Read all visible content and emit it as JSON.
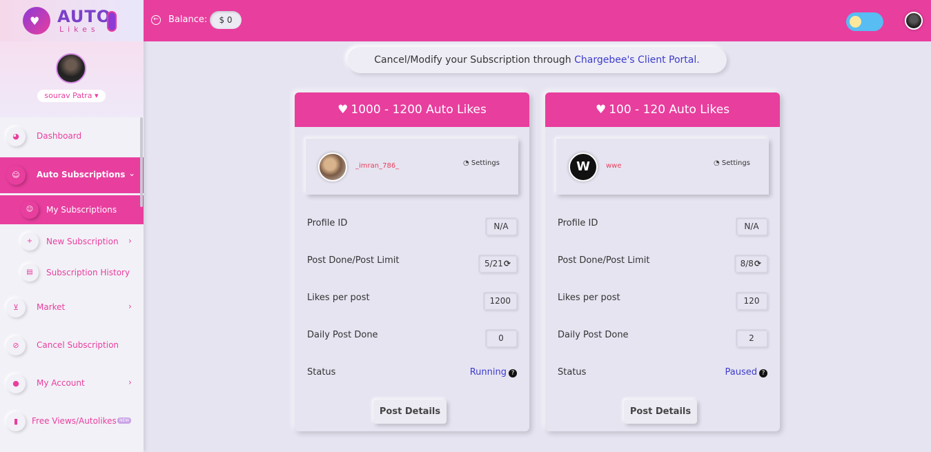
{
  "brand": {
    "name": "AUTO",
    "sub": "Likes",
    "badge": "IG"
  },
  "user": {
    "name": "sourav Patra"
  },
  "header": {
    "balance_label": "Balance:",
    "balance_value": "$ 0"
  },
  "sidebar": {
    "items": [
      {
        "label": "Dashboard",
        "icon": "pie-chart-icon"
      },
      {
        "label": "Auto Subscriptions",
        "icon": "users-icon",
        "chevron": "⌄"
      },
      {
        "label": "Market",
        "icon": "cart-icon",
        "chevron": "›"
      },
      {
        "label": "Cancel Subscription",
        "icon": "ban-icon"
      },
      {
        "label": "My Account",
        "icon": "user-icon",
        "chevron": "›"
      },
      {
        "label": "Free Views/Autolikes",
        "icon": "bookmark-icon",
        "badge": "NEW"
      }
    ],
    "subitems": [
      {
        "label": "My Subscriptions",
        "icon": "users-icon"
      },
      {
        "label": "New Subscription",
        "icon": "user-plus-icon",
        "chevron": "›"
      },
      {
        "label": "Subscription History",
        "icon": "clipboard-icon"
      }
    ]
  },
  "banner": {
    "text": "Cancel/Modify your Subscription through ",
    "link": "Chargebee's Client Portal."
  },
  "rows": {
    "profile_id": "Profile ID",
    "post_done": "Post Done/Post Limit",
    "likes_per_post": "Likes per post",
    "daily_post_done": "Daily Post Done",
    "status": "Status"
  },
  "cards": [
    {
      "title": "1000 - 1200 Auto Likes",
      "username": "_imran_786_",
      "settings": "Settings",
      "profile_id": "N/A",
      "post_done": "5/21",
      "likes_per_post": "1200",
      "daily_post_done": "0",
      "status": "Running",
      "button": "Post Details"
    },
    {
      "title": "100 - 120 Auto Likes",
      "username": "wwe",
      "settings": "Settings",
      "profile_id": "N/A",
      "post_done": "8/8",
      "likes_per_post": "120",
      "daily_post_done": "2",
      "status": "Paused",
      "button": "Post Details"
    }
  ],
  "colors": {
    "accent": "#e83e9e",
    "link": "#3b3bc9",
    "background": "#e6e4f1"
  }
}
